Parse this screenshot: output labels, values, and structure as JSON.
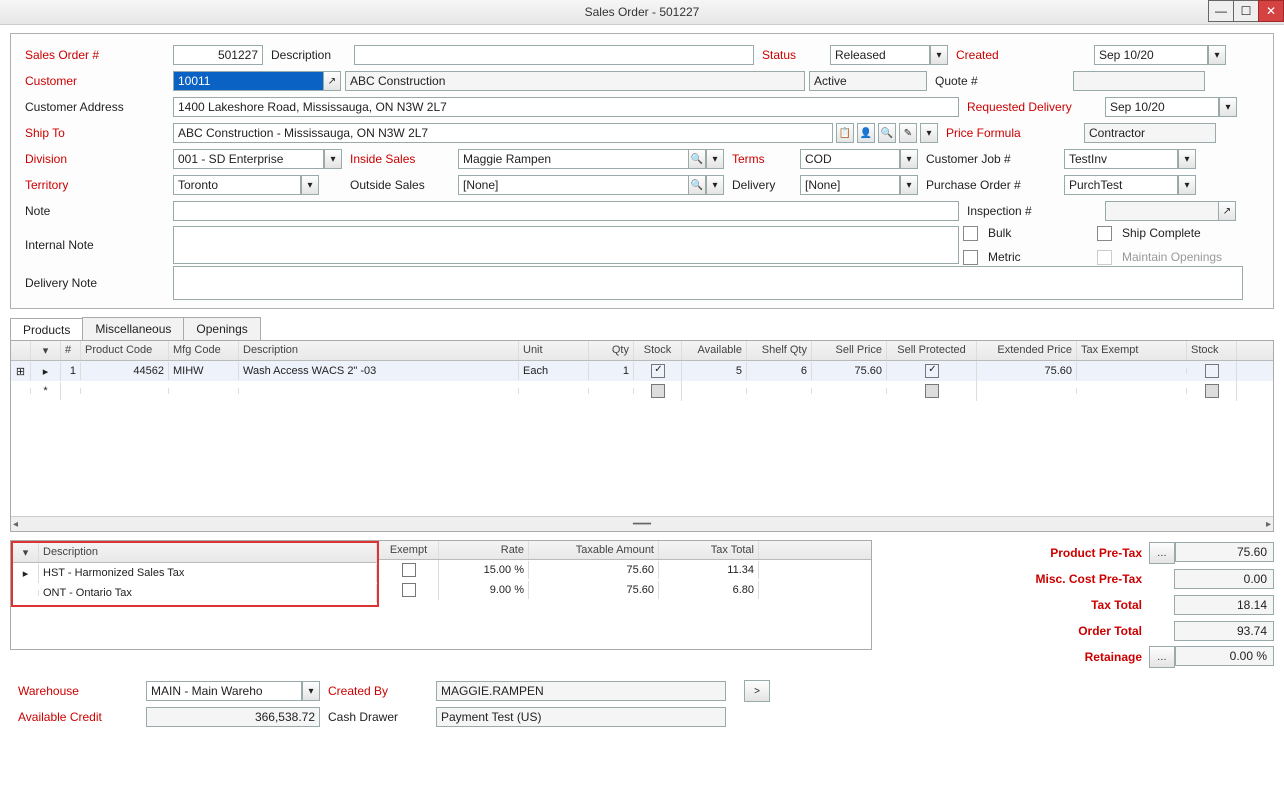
{
  "window": {
    "title": "Sales Order - 501227"
  },
  "header": {
    "sales_order_lbl": "Sales Order #",
    "sales_order": "501227",
    "description_lbl": "Description",
    "description": "",
    "status_lbl": "Status",
    "status": "Released",
    "created_lbl": "Created",
    "created": "Sep 10/20",
    "customer_lbl": "Customer",
    "customer_code": "10011",
    "customer_name": "ABC Construction",
    "customer_status": "Active",
    "quote_lbl": "Quote #",
    "quote": "",
    "cust_addr_lbl": "Customer Address",
    "cust_addr": "1400 Lakeshore Road, Mississauga, ON  N3W 2L7",
    "req_delivery_lbl": "Requested Delivery",
    "req_delivery": "Sep 10/20",
    "shipto_lbl": "Ship To",
    "shipto": "ABC Construction - Mississauga, ON  N3W 2L7",
    "price_formula_lbl": "Price Formula",
    "price_formula": "Contractor",
    "division_lbl": "Division",
    "division": "001 - SD Enterprise",
    "inside_sales_lbl": "Inside Sales",
    "inside_sales": "Maggie Rampen",
    "terms_lbl": "Terms",
    "terms": "COD",
    "cust_job_lbl": "Customer Job #",
    "cust_job": "TestInv",
    "territory_lbl": "Territory",
    "territory": "Toronto",
    "outside_sales_lbl": "Outside Sales",
    "outside_sales": "[None]",
    "delivery_lbl": "Delivery",
    "delivery": "[None]",
    "po_lbl": "Purchase Order #",
    "po": "PurchTest",
    "note_lbl": "Note",
    "note": "",
    "inspection_lbl": "Inspection #",
    "inspection": "",
    "internal_note_lbl": "Internal Note",
    "internal_note": "",
    "bulk_lbl": "Bulk",
    "metric_lbl": "Metric",
    "ship_complete_lbl": "Ship Complete",
    "maintain_openings_lbl": "Maintain Openings",
    "delivery_note_lbl": "Delivery Note",
    "delivery_note": ""
  },
  "tabs": {
    "products": "Products",
    "misc": "Miscellaneous",
    "openings": "Openings"
  },
  "grid": {
    "cols": {
      "num": "#",
      "code": "Product Code",
      "mfg": "Mfg Code",
      "desc": "Description",
      "unit": "Unit",
      "qty": "Qty",
      "stock": "Stock",
      "avail": "Available",
      "shelf": "Shelf Qty",
      "sell": "Sell Price",
      "prot": "Sell Protected",
      "ext": "Extended Price",
      "exempt": "Tax Exempt",
      "stock2": "Stock"
    },
    "rows": [
      {
        "num": "1",
        "code": "44562",
        "mfg": "MIHW",
        "desc": "Wash Access WACS 2\" -03",
        "unit": "Each",
        "qty": "1",
        "stock": true,
        "avail": "5",
        "shelf": "6",
        "sell": "75.60",
        "prot": true,
        "ext": "75.60",
        "exempt": ""
      }
    ]
  },
  "tax": {
    "cols": {
      "desc": "Description",
      "exempt": "Exempt",
      "rate": "Rate",
      "taxable": "Taxable Amount",
      "total": "Tax Total"
    },
    "rows": [
      {
        "desc": "HST - Harmonized Sales Tax",
        "exempt": false,
        "rate": "15.00 %",
        "taxable": "75.60",
        "total": "11.34"
      },
      {
        "desc": "ONT - Ontario Tax",
        "exempt": false,
        "rate": "9.00 %",
        "taxable": "75.60",
        "total": "6.80"
      }
    ]
  },
  "totals": {
    "product_pretax_lbl": "Product Pre-Tax",
    "product_pretax": "75.60",
    "misc_pretax_lbl": "Misc. Cost Pre-Tax",
    "misc_pretax": "0.00",
    "tax_total_lbl": "Tax Total",
    "tax_total": "18.14",
    "order_total_lbl": "Order Total",
    "order_total": "93.74",
    "retainage_lbl": "Retainage",
    "retainage": "0.00 %"
  },
  "footer": {
    "warehouse_lbl": "Warehouse",
    "warehouse": "MAIN - Main Wareho",
    "created_by_lbl": "Created By",
    "created_by": "MAGGIE.RAMPEN",
    "avail_credit_lbl": "Available Credit",
    "avail_credit": "366,538.72",
    "cash_drawer_lbl": "Cash Drawer",
    "cash_drawer": "Payment Test (US)",
    "go": ">"
  }
}
